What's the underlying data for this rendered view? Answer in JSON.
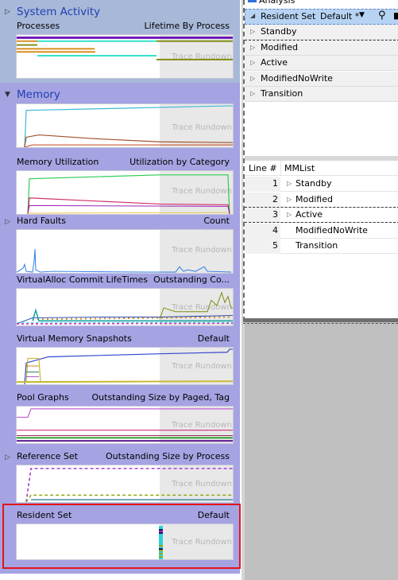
{
  "left": {
    "system_activity": {
      "title": "System Activity",
      "expander_icon": "triangle-right",
      "graph": {
        "label": "Processes",
        "preset": "Lifetime By Process",
        "rundown_label": "Trace Rundown",
        "colors": [
          "#6a16b5",
          "#d98a1b",
          "#2ee0c8",
          "#7f8a10"
        ]
      }
    },
    "memory": {
      "title": "Memory",
      "expander_icon": "triangle-down",
      "graphs": [
        {
          "label": "",
          "preset": "",
          "rundown_label": "Trace Rundown",
          "colors": [
            "#3cb8d8",
            "#a0522d",
            "#c0461a"
          ]
        },
        {
          "label": "Memory Utilization",
          "preset": "Utilization by Category",
          "rundown_label": "Trace Rundown",
          "colors": [
            "#2ecc52",
            "#d0306a",
            "#9c27b0",
            "#e8c040"
          ]
        },
        {
          "label": "Hard Faults",
          "preset": "Count",
          "rundown_label": "Trace Rundown",
          "has_expander": true,
          "colors": [
            "#2c7be5"
          ]
        },
        {
          "label": "VirtualAlloc Commit LifeTimes",
          "preset": "Outstanding Co...",
          "rundown_label": "Trace Rundown",
          "colors": [
            "#7f8a10",
            "#1a3fb0",
            "#d98a1b",
            "#19a3a3",
            "#d03ec8",
            "#2ee0e0"
          ]
        },
        {
          "label": "Virtual Memory Snapshots",
          "preset": "Default",
          "rundown_label": "Trace Rundown",
          "colors": [
            "#3344cc",
            "#c8b830",
            "#e07a1a",
            "#1a7a5a",
            "#a050c0"
          ]
        },
        {
          "label": "Pool Graphs",
          "preset": "Outstanding Size by Paged, Tag",
          "rundown_label": "Trace Rundown",
          "colors": [
            "#c060d0",
            "#d0307a",
            "#8a1040",
            "#2a9a2a",
            "#5a1a90"
          ]
        },
        {
          "label": "Reference Set",
          "preset": "Outstanding Size by Process",
          "rundown_label": "Trace Rundown",
          "has_expander": true,
          "colors": [
            "#a030d0",
            "#8aaa10",
            "#1a7a9a"
          ]
        },
        {
          "label": "Resident Set",
          "preset": "Default",
          "rundown_label": "Trace Rundown",
          "selected": true,
          "colors": [
            "#2ed0d8",
            "#1a1a5a",
            "#a030c0",
            "#8aaa10"
          ]
        }
      ]
    }
  },
  "analysis": {
    "tab_label": "Analysis",
    "toolbar": {
      "title": "Resident Set",
      "preset": "Default *",
      "dropdown_icon": "▼",
      "search_icon": "⚲",
      "collapse_icon": "◢"
    },
    "tree_rows": [
      "Standby",
      "Modified",
      "Active",
      "ModifiedNoWrite",
      "Transition"
    ],
    "grid": {
      "columns": [
        "Line #",
        "MMList"
      ],
      "rows": [
        {
          "line": "1",
          "mmlist": "Standby",
          "expandable": true
        },
        {
          "line": "2",
          "mmlist": "Modified",
          "expandable": true
        },
        {
          "line": "3",
          "mmlist": "Active",
          "expandable": true
        },
        {
          "line": "4",
          "mmlist": "ModifiedNoWrite",
          "expandable": false
        },
        {
          "line": "5",
          "mmlist": "Transition",
          "expandable": false
        }
      ]
    }
  }
}
